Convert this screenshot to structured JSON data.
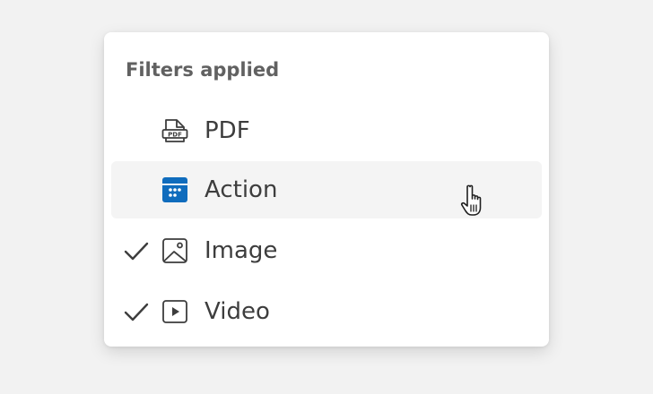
{
  "menu": {
    "header": "Filters applied",
    "items": [
      {
        "label": "PDF",
        "icon": "pdf-file-icon",
        "checked": false
      },
      {
        "label": "Action",
        "icon": "action-calendar-icon",
        "checked": false,
        "hovered": true
      },
      {
        "label": "Image",
        "icon": "image-icon",
        "checked": true
      },
      {
        "label": "Video",
        "icon": "video-play-icon",
        "checked": true
      }
    ],
    "icon_texts": {
      "pdf": "PDF"
    }
  },
  "colors": {
    "background": "#f2f2f2",
    "menu": "#ffffff",
    "hover": "#f4f4f4",
    "accent": "#0f6cbd",
    "text": "#3d3d3d",
    "header": "#616161"
  }
}
